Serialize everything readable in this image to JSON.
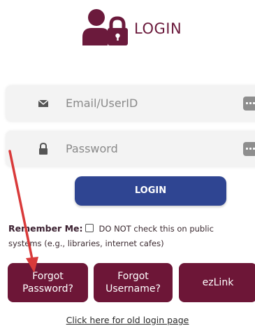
{
  "header": {
    "title": "LOGIN",
    "icon": "user-lock-icon",
    "color": "#6b1a3c"
  },
  "form": {
    "email_placeholder": "Email/UserID",
    "password_placeholder": "Password",
    "email_icon": "envelope-icon",
    "password_icon": "lock-icon",
    "login_label": "LOGIN",
    "login_color": "#2f4592"
  },
  "remember": {
    "label": "Remember Me:",
    "note": "DO NOT check this on public systems (e.g., libraries, internet cafes)"
  },
  "actions": {
    "forgot_password": "Forgot Password?",
    "forgot_username": "Forgot Username?",
    "ezlink": "ezLink",
    "color": "#6d1637"
  },
  "old_login_link": "Click here for old login page",
  "annotation_arrow_color": "#d93a3a"
}
